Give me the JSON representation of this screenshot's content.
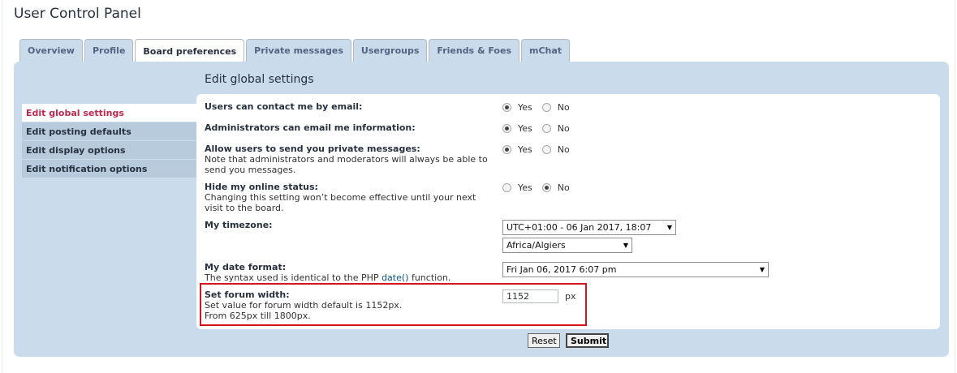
{
  "page_title": "User Control Panel",
  "tabs": [
    {
      "label": "Overview",
      "active": false
    },
    {
      "label": "Profile",
      "active": false
    },
    {
      "label": "Board preferences",
      "active": true
    },
    {
      "label": "Private messages",
      "active": false
    },
    {
      "label": "Usergroups",
      "active": false
    },
    {
      "label": "Friends & Foes",
      "active": false
    },
    {
      "label": "mChat",
      "active": false
    }
  ],
  "section_title": "Edit global settings",
  "sidenav": [
    {
      "label": "Edit global settings",
      "active": true
    },
    {
      "label": "Edit posting defaults",
      "active": false
    },
    {
      "label": "Edit display options",
      "active": false
    },
    {
      "label": "Edit notification options",
      "active": false
    }
  ],
  "settings": {
    "contact_email": {
      "label": "Users can contact me by email:",
      "value": "Yes"
    },
    "admin_email": {
      "label": "Administrators can email me information:",
      "value": "Yes"
    },
    "allow_pm": {
      "label": "Allow users to send you private messages:",
      "explain": "Note that administrators and moderators will always be able to send you messages.",
      "value": "Yes"
    },
    "hide_online": {
      "label": "Hide my online status:",
      "explain": "Changing this setting won’t become effective until your next visit to the board.",
      "value": "No"
    },
    "timezone": {
      "label": "My timezone:",
      "offset": "UTC+01:00 - 06 Jan 2017, 18:07",
      "zone": "Africa/Algiers"
    },
    "date_format": {
      "label": "My date format:",
      "explain_prefix": "The syntax used is identical to the PHP ",
      "explain_link": "date()",
      "explain_suffix": " function.",
      "value": "Fri Jan 06, 2017 6:07 pm"
    },
    "forum_width": {
      "label": "Set forum width:",
      "explain_line1": "Set value for forum width default is 1152px.",
      "explain_line2": "From 625px till 1800px.",
      "value": "1152",
      "unit": "px"
    }
  },
  "radio_labels": {
    "yes": "Yes",
    "no": "No"
  },
  "buttons": {
    "reset": "Reset",
    "submit": "Submit"
  },
  "colors": {
    "accent_red": "#d6141c",
    "active_nav": "#bc2a4d",
    "panel_bg": "#cadceb"
  }
}
